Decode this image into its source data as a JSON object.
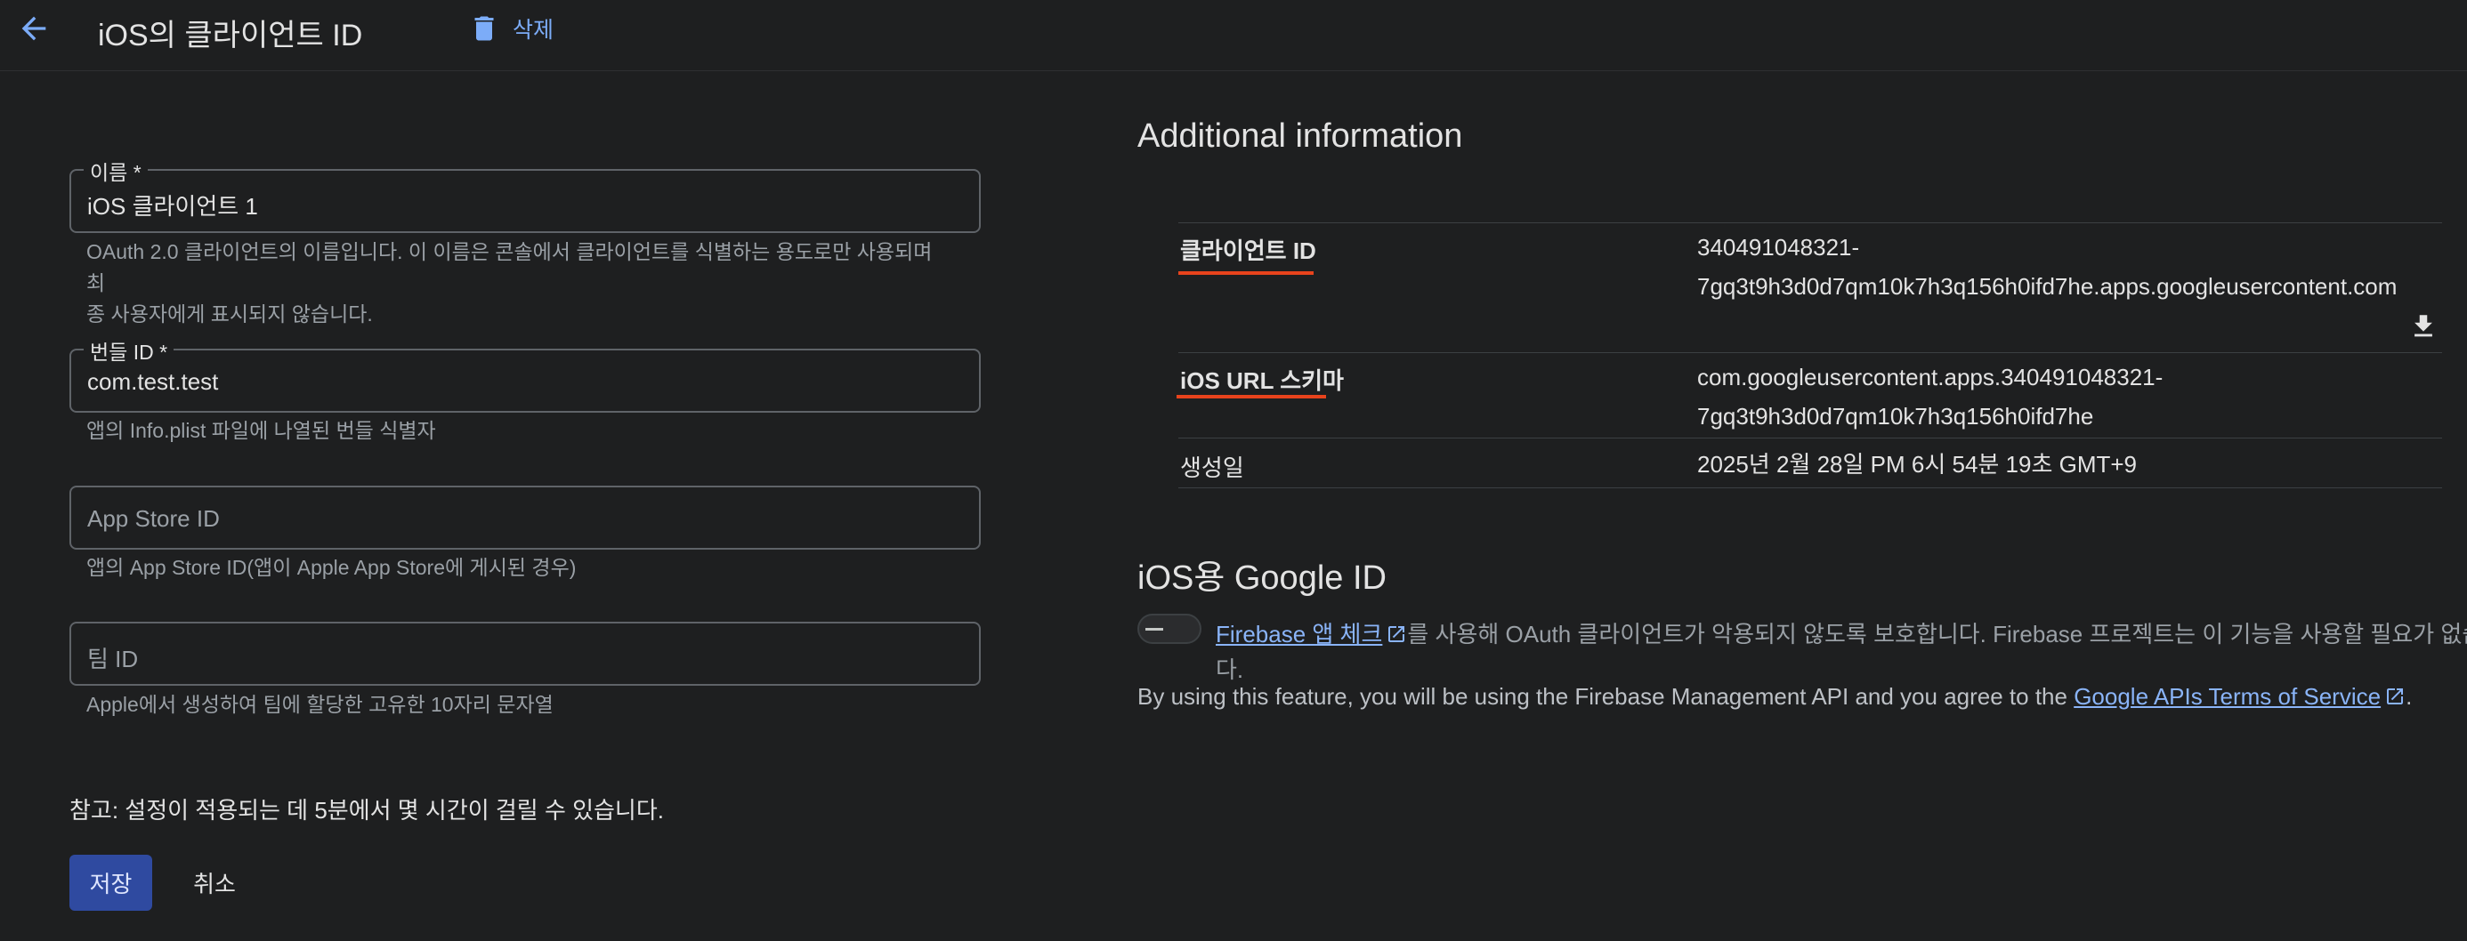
{
  "header": {
    "title": "iOS의 클라이언트 ID",
    "delete_label": "삭제"
  },
  "form": {
    "name": {
      "label": "이름 *",
      "value": "iOS 클라이언트 1",
      "hint_line1": "OAuth 2.0 클라이언트의 이름입니다. 이 이름은 콘솔에서 클라이언트를 식별하는 용도로만 사용되며 최",
      "hint_line2": "종 사용자에게 표시되지 않습니다."
    },
    "bundle_id": {
      "label": "번들 ID *",
      "value": "com.test.test",
      "hint": "앱의 Info.plist 파일에 나열된 번들 식별자"
    },
    "app_store_id": {
      "placeholder": "App Store ID",
      "hint": "앱의 App Store ID(앱이 Apple App Store에 게시된 경우)"
    },
    "team_id": {
      "placeholder": "팀 ID",
      "hint": "Apple에서 생성하여 팀에 할당한 고유한 10자리 문자열"
    },
    "note": "참고: 설정이 적용되는 데 5분에서 몇 시간이 걸릴 수 있습니다.",
    "save_label": "저장",
    "cancel_label": "취소"
  },
  "additional_info": {
    "title": "Additional information",
    "client_id_key": "클라이언트 ID",
    "client_id_line1": "340491048321-",
    "client_id_line2": "7gq3t9h3d0d7qm10k7h3q156h0ifd7he.apps.googleusercontent.com",
    "url_scheme_key": "iOS URL 스키마",
    "url_scheme_line1": "com.googleusercontent.apps.340491048321-",
    "url_scheme_line2": "7gq3t9h3d0d7qm10k7h3q156h0ifd7he",
    "created_key": "생성일",
    "created_value": "2025년 2월 28일 PM 6시 54분 19초 GMT+9"
  },
  "google_id": {
    "title": "iOS용 Google ID",
    "firebase_link": "Firebase 앱 체크",
    "desc_rest_line1": "를 사용해 OAuth 클라이언트가 악용되지 않도록 보호합니다. Firebase 프로젝트는 이 기능을 사용할 필요가 없습니",
    "desc_rest_line2": "다.",
    "terms_prefix": "By using this feature, you will be using the Firebase Management API and you agree to the ",
    "terms_link": "Google APIs Terms of Service",
    "terms_suffix": "."
  },
  "colors": {
    "background": "#1e1f20",
    "accent_link": "#8ab4f8",
    "primary_button": "#2f4aa0",
    "highlight_underline": "#e8431c"
  },
  "icons": {
    "back": "arrow-left-icon",
    "delete": "trash-icon",
    "download": "download-icon",
    "external": "external-link-icon"
  }
}
